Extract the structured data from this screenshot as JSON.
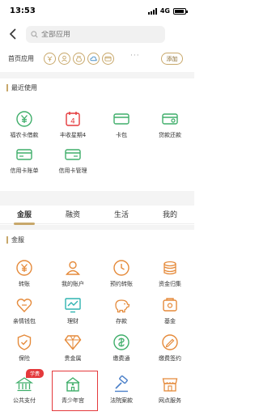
{
  "status_bar": {
    "time": "13:53",
    "network": "4G"
  },
  "search": {
    "placeholder": "全部应用"
  },
  "homepage_apps": {
    "label": "首页应用",
    "add_label": "添加",
    "more": "···"
  },
  "recent": {
    "title": "最近使用",
    "items": [
      {
        "label": "福农卡借款",
        "icon": "yuan-coin-icon"
      },
      {
        "label": "丰收星期4",
        "icon": "calendar-icon"
      },
      {
        "label": "卡包",
        "icon": "card-icon"
      },
      {
        "label": "贷款还款",
        "icon": "loan-card-icon"
      },
      {
        "label": "信用卡账单",
        "icon": "bill-icon"
      },
      {
        "label": "信用卡管理",
        "icon": "card-manage-icon"
      }
    ]
  },
  "tabs": [
    "金服",
    "融资",
    "生活",
    "我的"
  ],
  "finance": {
    "title": "金服",
    "badge": "学费",
    "items": [
      {
        "label": "转账",
        "icon": "yuan-transfer-icon"
      },
      {
        "label": "我的账户",
        "icon": "account-icon"
      },
      {
        "label": "预约转账",
        "icon": "scheduled-transfer-icon"
      },
      {
        "label": "资金归集",
        "icon": "coins-icon"
      },
      {
        "label": "亲情钱包",
        "icon": "heart-wallet-icon"
      },
      {
        "label": "理财",
        "icon": "chart-icon"
      },
      {
        "label": "存款",
        "icon": "piggy-bank-icon"
      },
      {
        "label": "基金",
        "icon": "fund-icon"
      },
      {
        "label": "保险",
        "icon": "shield-icon"
      },
      {
        "label": "贵金属",
        "icon": "diamond-icon"
      },
      {
        "label": "缴费通",
        "icon": "payment-icon"
      },
      {
        "label": "缴费签约",
        "icon": "sign-icon"
      },
      {
        "label": "公共支付",
        "icon": "public-pay-icon"
      },
      {
        "label": "青少年宫",
        "icon": "youth-palace-icon"
      },
      {
        "label": "法院案款",
        "icon": "gavel-icon"
      },
      {
        "label": "网点服务",
        "icon": "branch-icon"
      }
    ]
  },
  "colors": {
    "accent": "#c8a86b",
    "green": "#3fae6a",
    "red": "#e4393c",
    "orange": "#e58a3a",
    "teal": "#2fb3b0"
  }
}
